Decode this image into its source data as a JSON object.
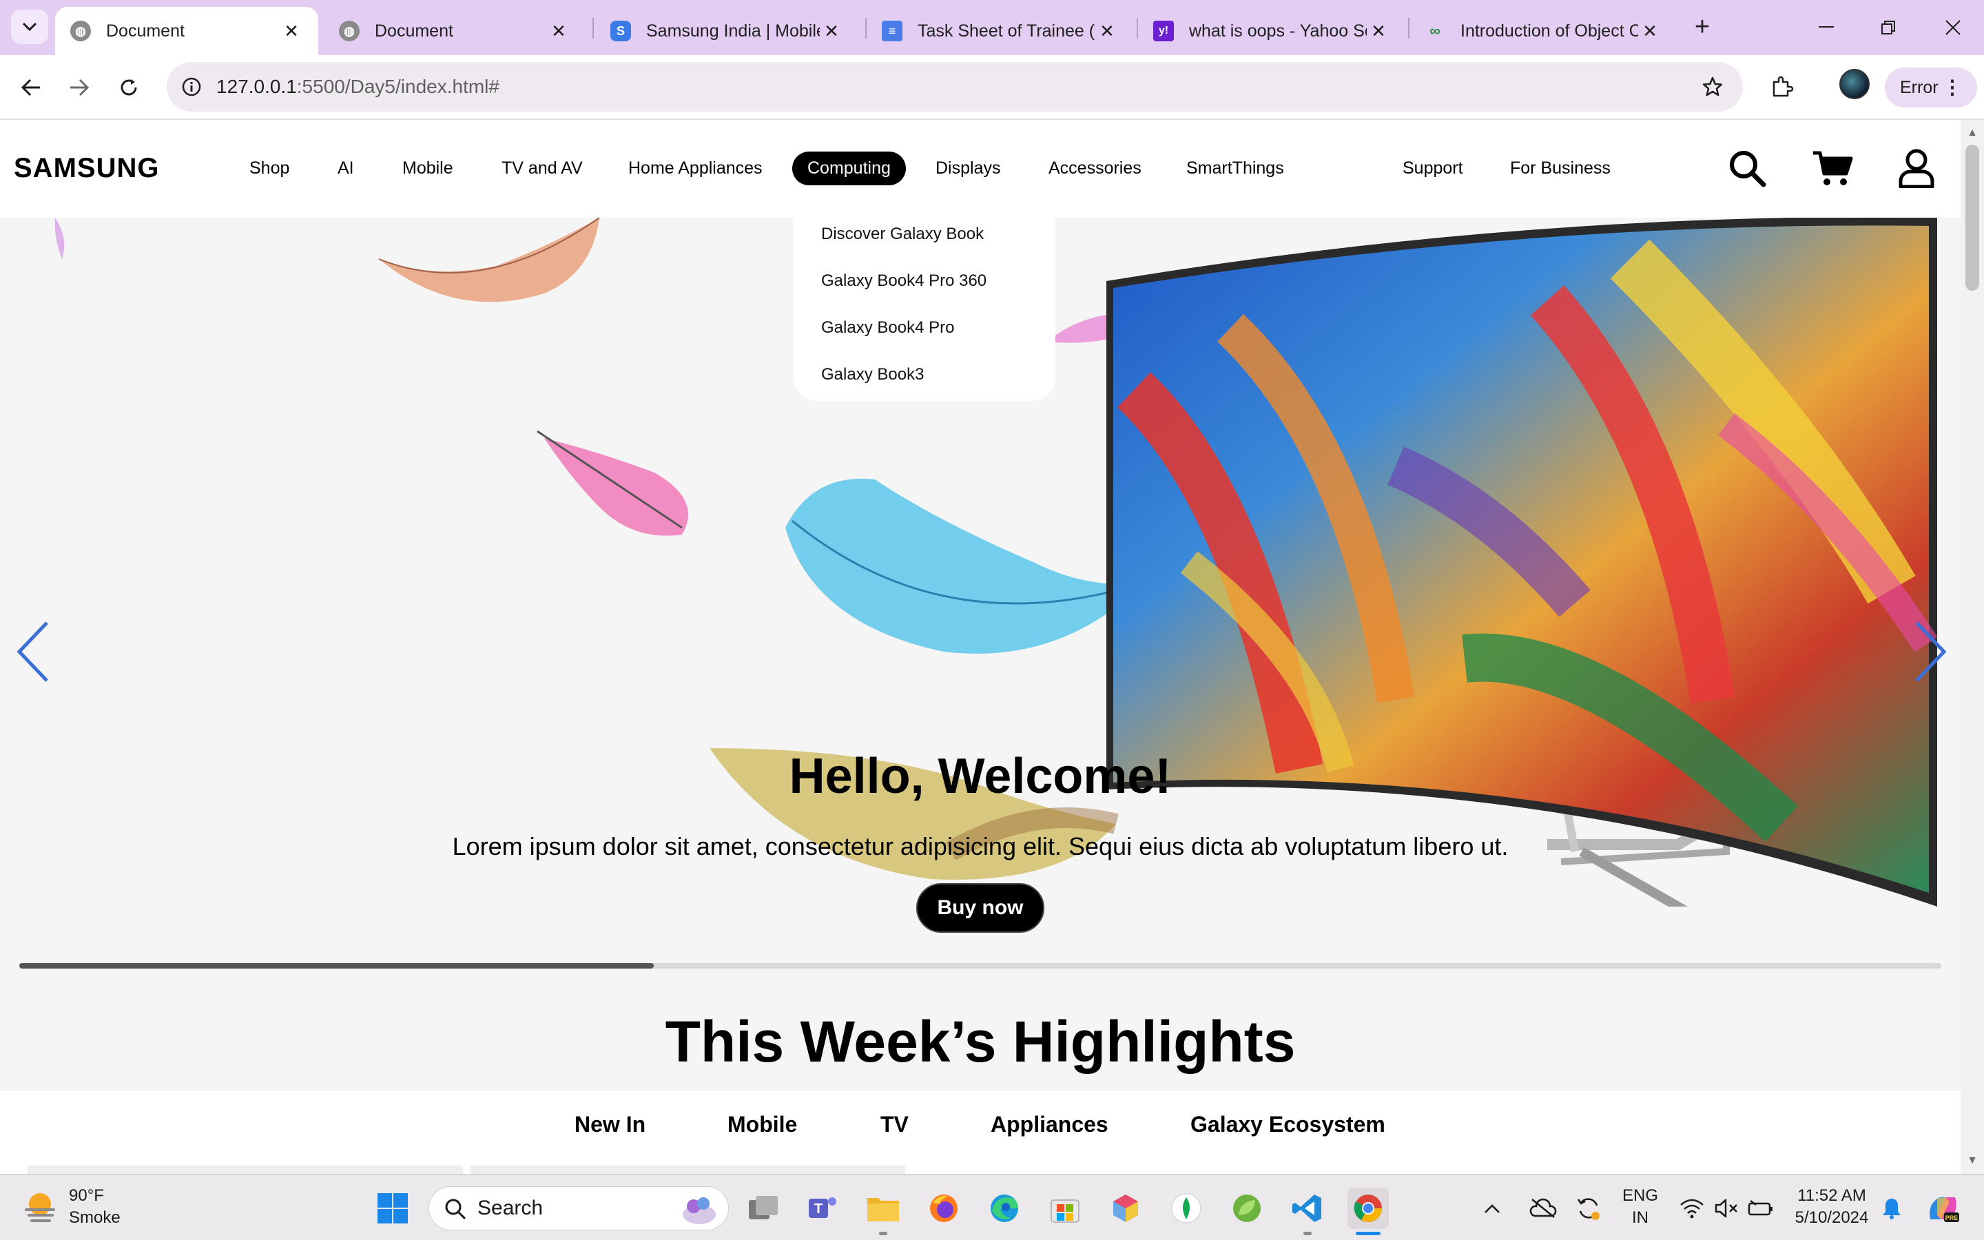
{
  "browser": {
    "tabs": [
      {
        "title": "Document",
        "active": true,
        "favicon": "globe-icon"
      },
      {
        "title": "Document",
        "active": false,
        "favicon": "globe-icon"
      },
      {
        "title": "Samsung India | Mobile",
        "active": false,
        "favicon": "samsung-s-icon"
      },
      {
        "title": "Task Sheet of Trainee (H",
        "active": false,
        "favicon": "docs-icon"
      },
      {
        "title": "what is oops - Yahoo Se",
        "active": false,
        "favicon": "yahoo-icon"
      },
      {
        "title": "Introduction of Object C",
        "active": false,
        "favicon": "gfg-icon"
      }
    ],
    "url_host": "127.0.0.1",
    "url_path": ":5500/Day5/index.html#",
    "profile_status": "Error"
  },
  "site": {
    "logo": "SAMSUNG",
    "nav": [
      "Shop",
      "AI",
      "Mobile",
      "TV and AV",
      "Home Appliances",
      "Computing",
      "Displays",
      "Accessories",
      "SmartThings"
    ],
    "nav_active": "Computing",
    "nav_right": [
      "Support",
      "For Business"
    ],
    "dropdown": [
      "Discover Galaxy Book",
      "Galaxy Book4 Pro 360",
      "Galaxy Book4 Pro",
      "Galaxy Book3"
    ],
    "hero": {
      "title": "Hello, Welcome!",
      "text": "Lorem ipsum dolor sit amet, consectetur adipisicing elit. Sequi eius dicta ab voluptatum libero ut.",
      "button": "Buy now",
      "slide_progress": 0.33
    },
    "highlights": {
      "title": "This Week’s Highlights",
      "tabs": [
        "New In",
        "Mobile",
        "TV",
        "Appliances",
        "Galaxy Ecosystem"
      ]
    }
  },
  "taskbar": {
    "weather_temp": "90°F",
    "weather_cond": "Smoke",
    "search_placeholder": "Search",
    "lang_line1": "ENG",
    "lang_line2": "IN",
    "time": "11:52 AM",
    "date": "5/10/2024"
  },
  "colors": {
    "chrome_frame": "#e4cdf2",
    "accent_arrow": "#3b6fd8",
    "button_black": "#000000"
  }
}
